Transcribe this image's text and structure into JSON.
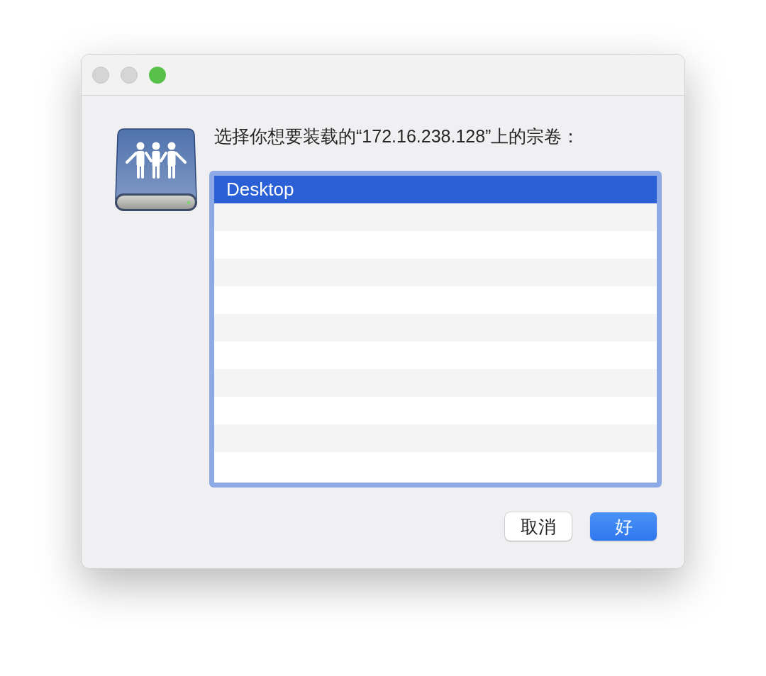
{
  "window": {
    "title_bar": {
      "buttons": [
        {
          "kind": "close",
          "disabled": true
        },
        {
          "kind": "minimize",
          "disabled": true
        },
        {
          "kind": "zoom",
          "disabled": false
        }
      ]
    }
  },
  "dialog": {
    "message": "选择你想要装载的“172.16.238.128”上的宗卷：",
    "volumes": [
      {
        "label": "Desktop",
        "selected": true
      }
    ],
    "buttons": [
      {
        "label": "取消",
        "kind": "cancel"
      },
      {
        "label": "好",
        "kind": "default"
      }
    ]
  }
}
